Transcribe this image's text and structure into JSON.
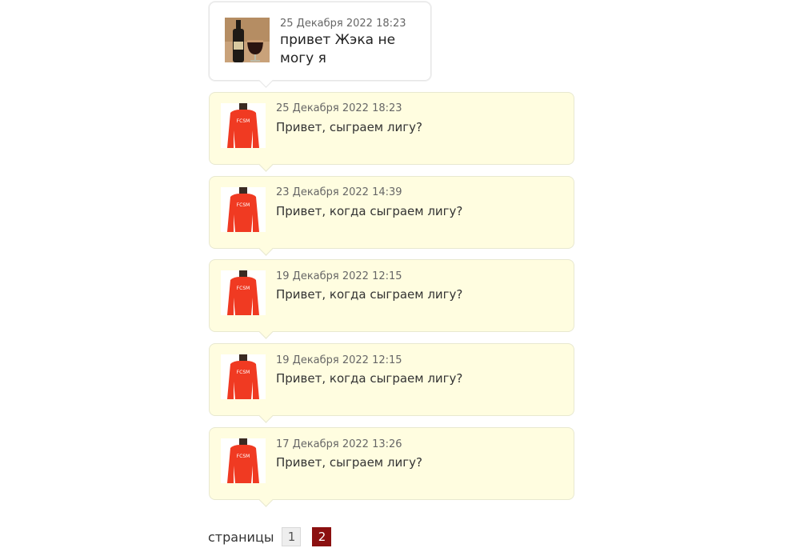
{
  "messages": [
    {
      "date": "25 Декабря 2022 18:23",
      "text": "привет Жэка не могу я",
      "avatar": "beer-glass-avatar",
      "style": "white"
    },
    {
      "date": "25 Декабря 2022 18:23",
      "text": "Привет, сыграем лигу?",
      "avatar": "red-jersey-avatar",
      "style": "yellow"
    },
    {
      "date": "23 Декабря 2022 14:39",
      "text": "Привет, когда сыграем лигу?",
      "avatar": "red-jersey-avatar",
      "style": "yellow"
    },
    {
      "date": "19 Декабря 2022 12:15",
      "text": "Привет, когда сыграем лигу?",
      "avatar": "red-jersey-avatar",
      "style": "yellow"
    },
    {
      "date": "19 Декабря 2022 12:15",
      "text": "Привет, когда сыграем лигу?",
      "avatar": "red-jersey-avatar",
      "style": "yellow"
    },
    {
      "date": "17 Декабря 2022 13:26",
      "text": "Привет, сыграем лигу?",
      "avatar": "red-jersey-avatar",
      "style": "yellow"
    }
  ],
  "jersey_text": "FCSM",
  "pagination": {
    "label": "страницы",
    "pages": [
      "1",
      "2"
    ],
    "current": "2"
  },
  "colors": {
    "bubble_yellow": "#fffde0",
    "jersey_red": "#f03a22",
    "active_page": "#8b1010"
  }
}
